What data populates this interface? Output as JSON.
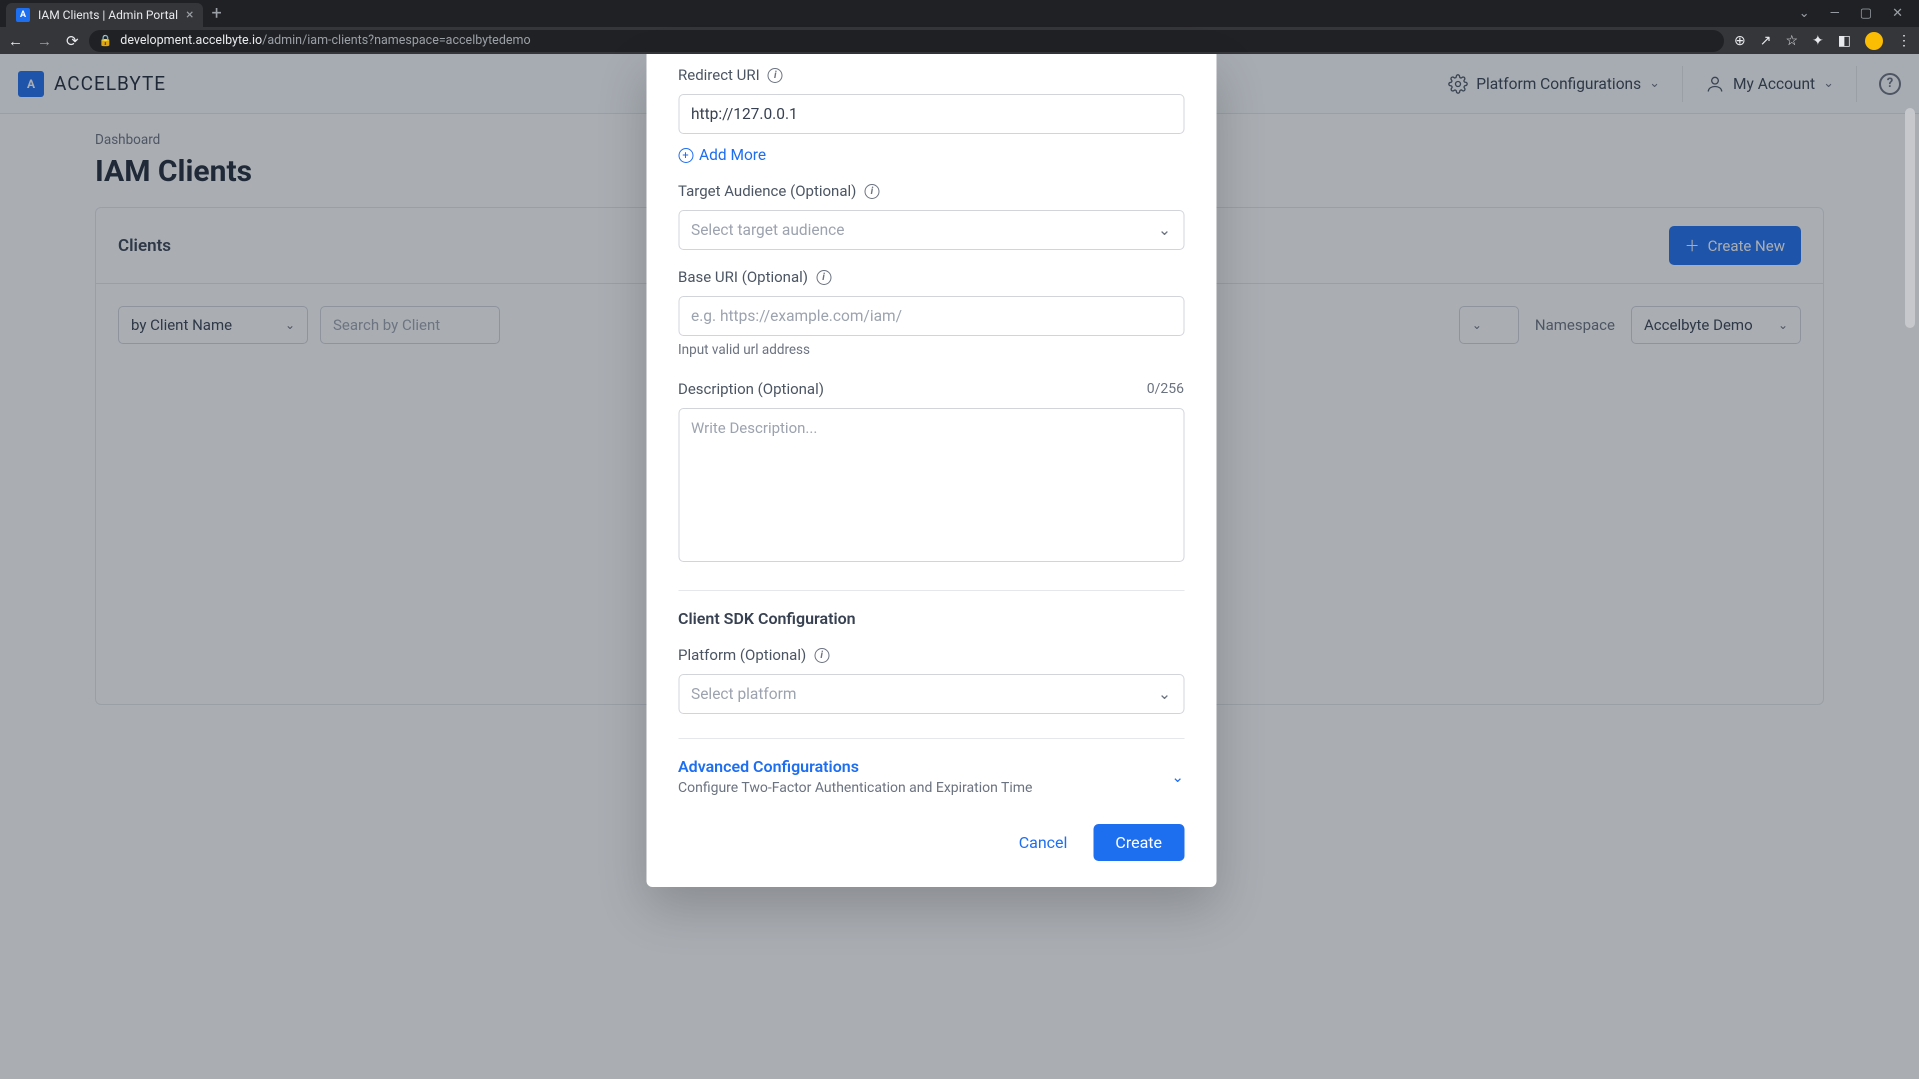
{
  "browser": {
    "tab_title": "IAM Clients | Admin Portal",
    "url_host": "development.accelbyte.io",
    "url_path": "/admin/iam-clients?namespace=accelbytedemo"
  },
  "header": {
    "brand": "ACCELBYTE",
    "platform_config": "Platform Configurations",
    "my_account": "My Account"
  },
  "page": {
    "breadcrumb": "Dashboard",
    "title": "IAM Clients",
    "card_title": "Clients",
    "create_new": "Create New",
    "filter_by": "by Client Name",
    "search_placeholder": "Search by Client",
    "namespace_label": "Namespace",
    "namespace_value": "Accelbyte Demo"
  },
  "modal": {
    "redirect_uri_label": "Redirect URI",
    "redirect_uri_value": "http://127.0.0.1",
    "add_more": "Add More",
    "target_audience_label": "Target Audience (Optional)",
    "target_audience_placeholder": "Select target audience",
    "base_uri_label": "Base URI (Optional)",
    "base_uri_placeholder": "e.g. https://example.com/iam/",
    "base_uri_helper": "Input valid url address",
    "description_label": "Description (Optional)",
    "description_counter": "0/256",
    "description_placeholder": "Write Description...",
    "sdk_section": "Client SDK Configuration",
    "platform_label": "Platform (Optional)",
    "platform_placeholder": "Select platform",
    "advanced_title": "Advanced Configurations",
    "advanced_sub": "Configure Two-Factor Authentication and Expiration Time",
    "cancel": "Cancel",
    "create": "Create"
  }
}
